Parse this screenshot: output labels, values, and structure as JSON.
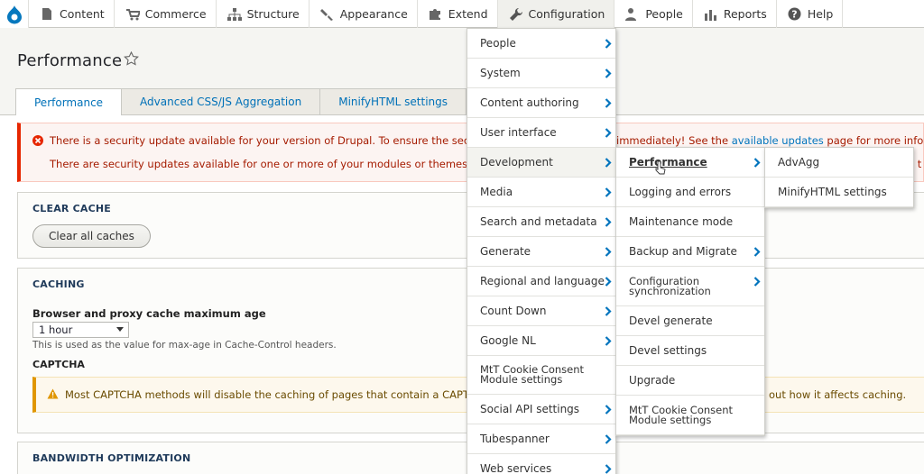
{
  "toolbar": {
    "items": [
      {
        "label": "Content",
        "icon": "document-icon"
      },
      {
        "label": "Commerce",
        "icon": "cart-icon"
      },
      {
        "label": "Structure",
        "icon": "structure-icon"
      },
      {
        "label": "Appearance",
        "icon": "paintbrush-icon"
      },
      {
        "label": "Extend",
        "icon": "puzzle-icon"
      },
      {
        "label": "Configuration",
        "icon": "wrench-icon"
      },
      {
        "label": "People",
        "icon": "person-icon"
      },
      {
        "label": "Reports",
        "icon": "bar-chart-icon"
      },
      {
        "label": "Help",
        "icon": "help-icon"
      }
    ]
  },
  "page": {
    "title": "Performance"
  },
  "tabs": [
    "Performance",
    "Advanced CSS/JS Aggregation",
    "MinifyHTML settings"
  ],
  "error": {
    "line1_start": "There is a security update available for your version of Drupal. To ensure the security of",
    "line1_end_pre": "immediately! See the ",
    "line1_link": "available updates",
    "line1_end_post": " page for more informati",
    "line2_start": "There are security updates available for one or more of your modules or themes. To ens",
    "line2_end": "e t"
  },
  "clear_cache": {
    "title": "Clear cache",
    "button": "Clear all caches"
  },
  "caching": {
    "title": "Caching",
    "max_age_label": "Browser and proxy cache maximum age",
    "max_age_value": "1 hour",
    "max_age_desc": "This is used as the value for max-age in Cache-Control headers.",
    "captcha_title": "CAPTCHA",
    "captcha_warning_start": "Most CAPTCHA methods will disable the caching of pages that contain a CAPTCHA e",
    "captcha_warning_end": "out how it affects caching."
  },
  "bandwidth": {
    "title": "Bandwidth optimization"
  },
  "menu_config": [
    "People",
    "System",
    "Content authoring",
    "User interface",
    "Development",
    "Media",
    "Search and metadata",
    "Generate",
    "Regional and language",
    "Count Down",
    "Google NL",
    "MtT Cookie Consent Module settings",
    "Social API settings",
    "Tubespanner",
    "Web services"
  ],
  "menu_dev": [
    "Performance",
    "Logging and errors",
    "Maintenance mode",
    "Backup and Migrate",
    "Configuration synchronization",
    "Devel generate",
    "Devel settings",
    "Upgrade",
    "MtT Cookie Consent Module settings"
  ],
  "menu_perf": [
    "AdvAgg",
    "MinifyHTML settings"
  ]
}
